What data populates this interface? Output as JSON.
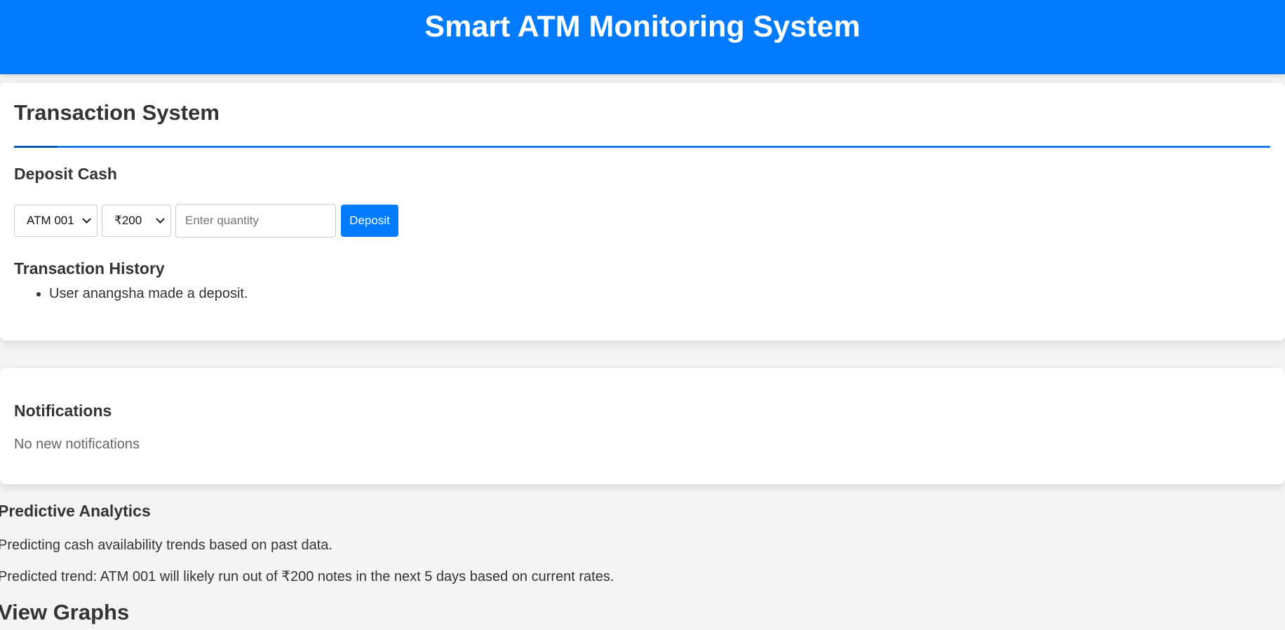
{
  "header": {
    "title": "Smart ATM Monitoring System"
  },
  "transaction": {
    "title": "Transaction System",
    "deposit": {
      "heading": "Deposit Cash",
      "atm_selected": "ATM 001",
      "denomination_selected": "₹200",
      "quantity_placeholder": "Enter quantity",
      "quantity_value": "",
      "button_label": "Deposit"
    },
    "history": {
      "heading": "Transaction History",
      "items": [
        "User anangsha made a deposit."
      ]
    }
  },
  "notifications": {
    "heading": "Notifications",
    "text": "No new notifications"
  },
  "analytics": {
    "heading": "Predictive Analytics",
    "description": "Predicting cash availability trends based on past data.",
    "prediction": "Predicted trend: ATM 001 will likely run out of ₹200 notes in the next 5 days based on current rates."
  },
  "graphs": {
    "heading": "View Graphs"
  },
  "colors": {
    "accent": "#007bff",
    "background": "#f4f4f4",
    "card": "#ffffff",
    "text": "#333333"
  }
}
